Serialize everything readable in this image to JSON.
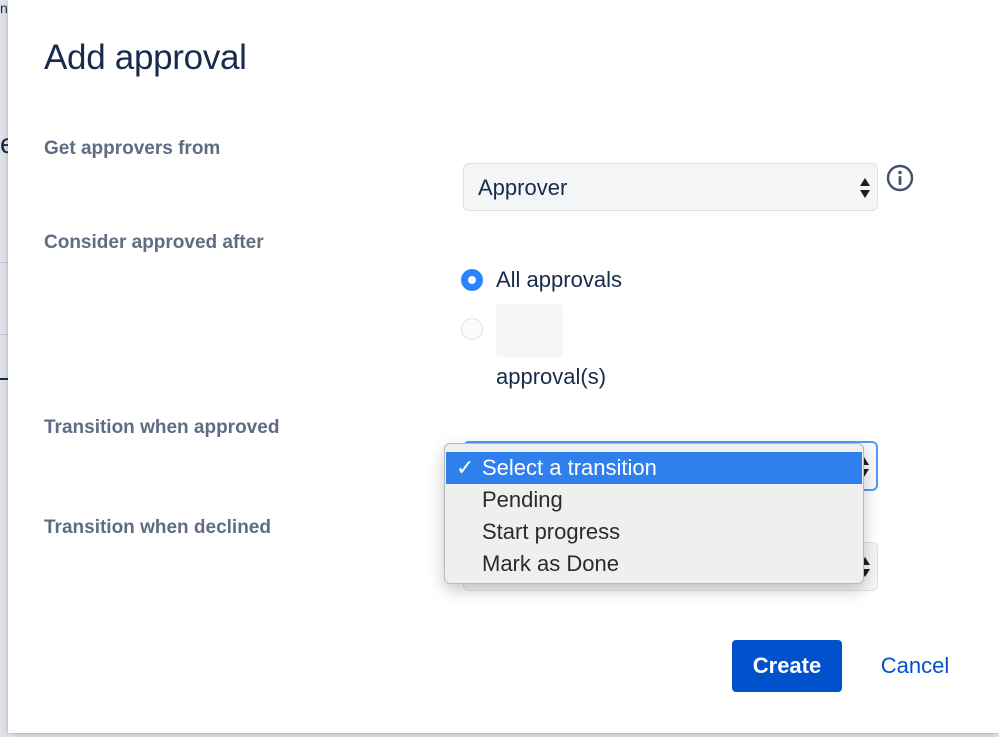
{
  "dialog": {
    "title": "Add approval"
  },
  "fields": {
    "approvers_label": "Get approvers from",
    "approvers_value": "Approver",
    "consider_label": "Consider approved after",
    "radio_all_label": "All approvals",
    "radio_count_suffix": "approval(s)",
    "radio_count_value": "",
    "approved_transition_label": "Transition when approved",
    "declined_transition_label": "Transition when declined"
  },
  "dropdown": {
    "options": [
      {
        "label": "Select a transition",
        "selected": true
      },
      {
        "label": "Pending",
        "selected": false
      },
      {
        "label": "Start progress",
        "selected": false
      },
      {
        "label": "Mark as Done",
        "selected": false
      }
    ],
    "check_mark": "✓"
  },
  "actions": {
    "create_label": "Create",
    "cancel_label": "Cancel"
  },
  "icons": {
    "info": "info-icon",
    "select_arrows": "up-down-arrows-icon",
    "check": "check-icon"
  },
  "colors": {
    "primary": "#0052cc",
    "radio_checked": "#2684ff",
    "focus_ring": "#4c9aff",
    "menu_highlight": "#2f80ed"
  }
}
